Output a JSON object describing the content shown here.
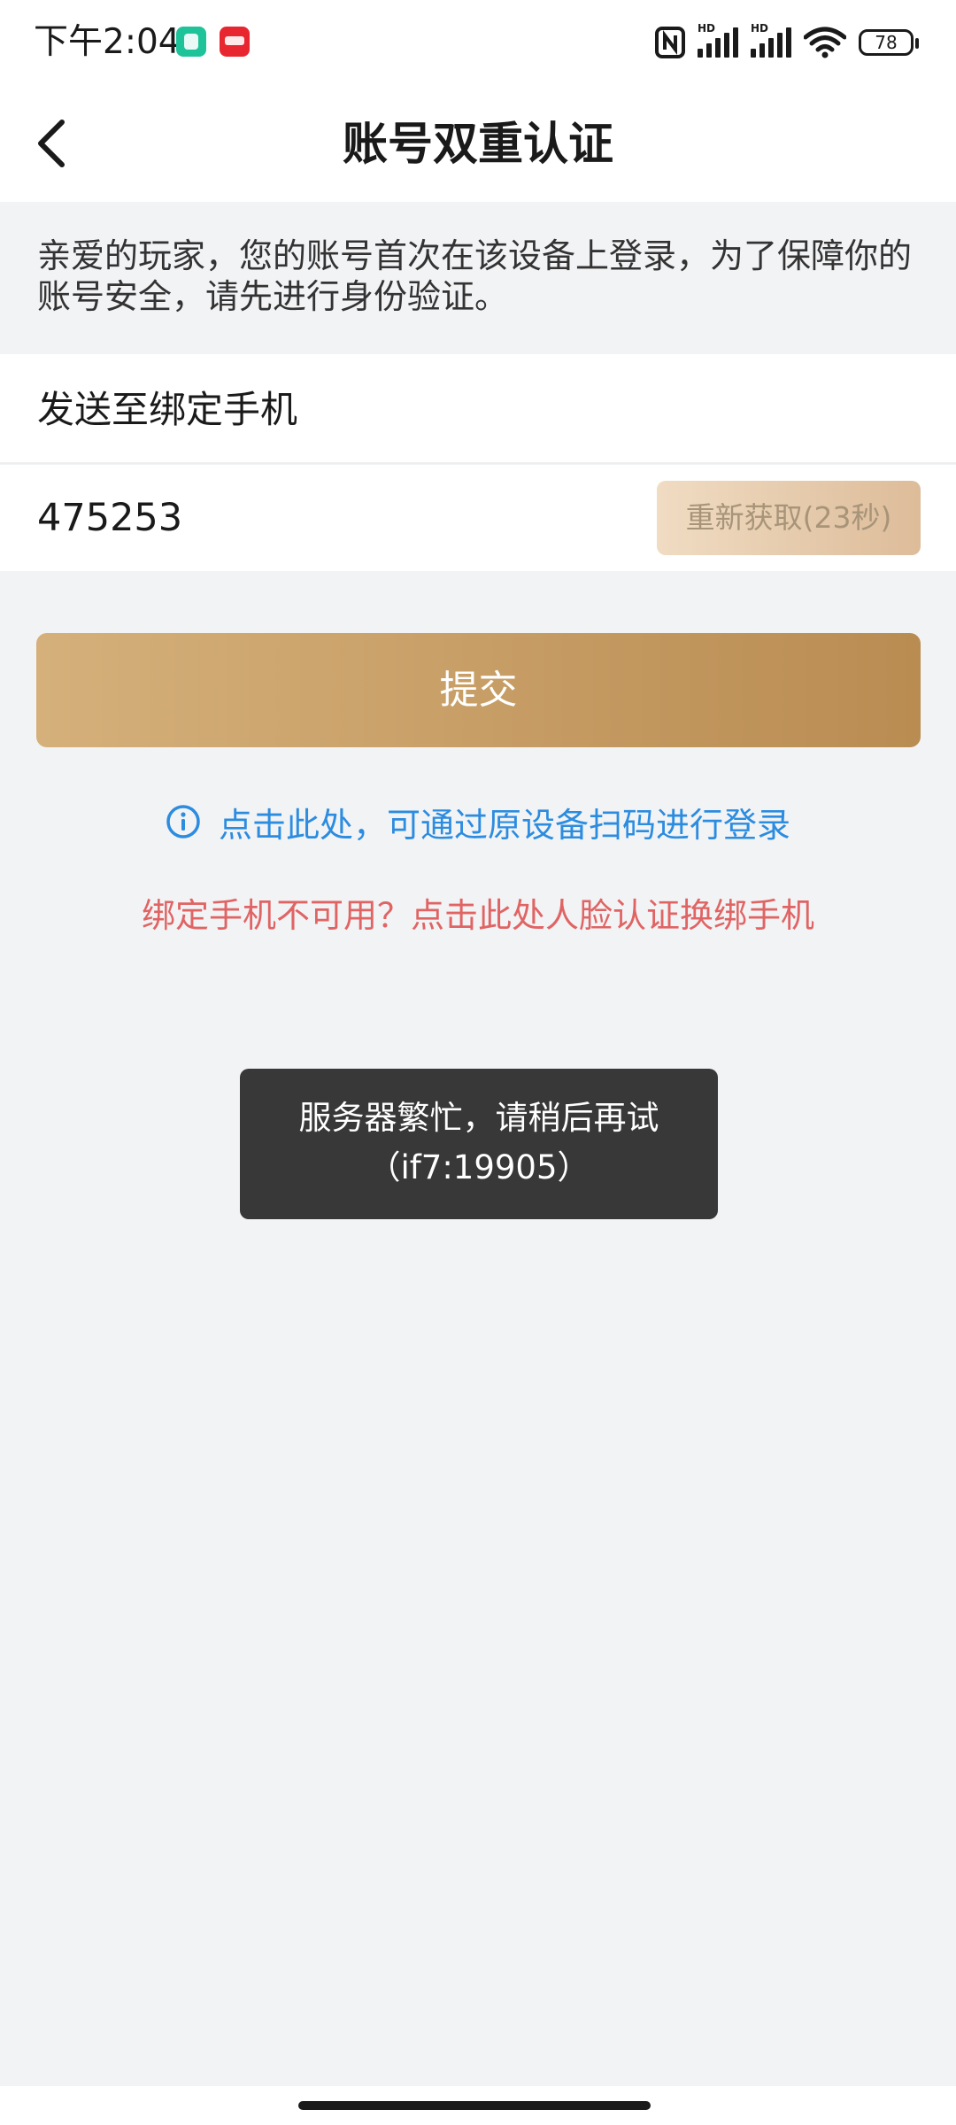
{
  "status_bar": {
    "time": "下午2:04",
    "battery": "78",
    "hd_label": "HD"
  },
  "header": {
    "title": "账号双重认证"
  },
  "notice": {
    "text": "亲爱的玩家，您的账号首次在该设备上登录，为了保障你的账号安全，请先进行身份验证。"
  },
  "form": {
    "phone_label": "发送至绑定手机",
    "code_value": "475253",
    "resend_label": "重新获取(23秒)"
  },
  "submit_label": "提交",
  "links": {
    "scan_login": "点击此处，可通过原设备扫码进行登录",
    "face_rebind": "绑定手机不可用？点击此处人脸认证换绑手机"
  },
  "toast": {
    "message": "服务器繁忙，请稍后再试（if7:19905）"
  },
  "colors": {
    "link_blue": "#2b8ce0",
    "link_red": "#e06464",
    "gold_start": "#d5b07a",
    "gold_end": "#b98c52"
  }
}
